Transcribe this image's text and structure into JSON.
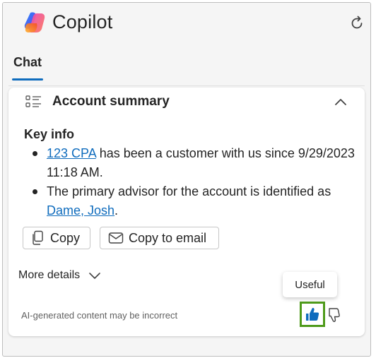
{
  "app": {
    "title": "Copilot"
  },
  "tabs": [
    {
      "label": "Chat"
    }
  ],
  "card": {
    "section_title": "Account summary",
    "heading": "Key info",
    "bullets": [
      {
        "link": "123 CPA",
        "text": " has been a customer with us since 9/29/2023 11:18 AM."
      },
      {
        "text": "The primary advisor for the account is identified as ",
        "link": "Dame, Josh",
        "suffix": "."
      }
    ],
    "buttons": {
      "copy": "Copy",
      "copy_email": "Copy to email"
    },
    "more_details": "More details",
    "disclaimer": "AI-generated content may be incorrect",
    "tooltip": "Useful"
  },
  "icons": {
    "logo": "copilot-logo",
    "refresh": "refresh-icon",
    "section": "list-icon",
    "collapse": "chevron-up-icon",
    "copy": "copy-icon",
    "email": "mail-icon",
    "more": "chevron-down-icon",
    "like": "thumbs-up-icon",
    "dislike": "thumbs-down-icon"
  },
  "colors": {
    "accent": "#0f6cbd",
    "highlight": "#4e9a1a"
  }
}
